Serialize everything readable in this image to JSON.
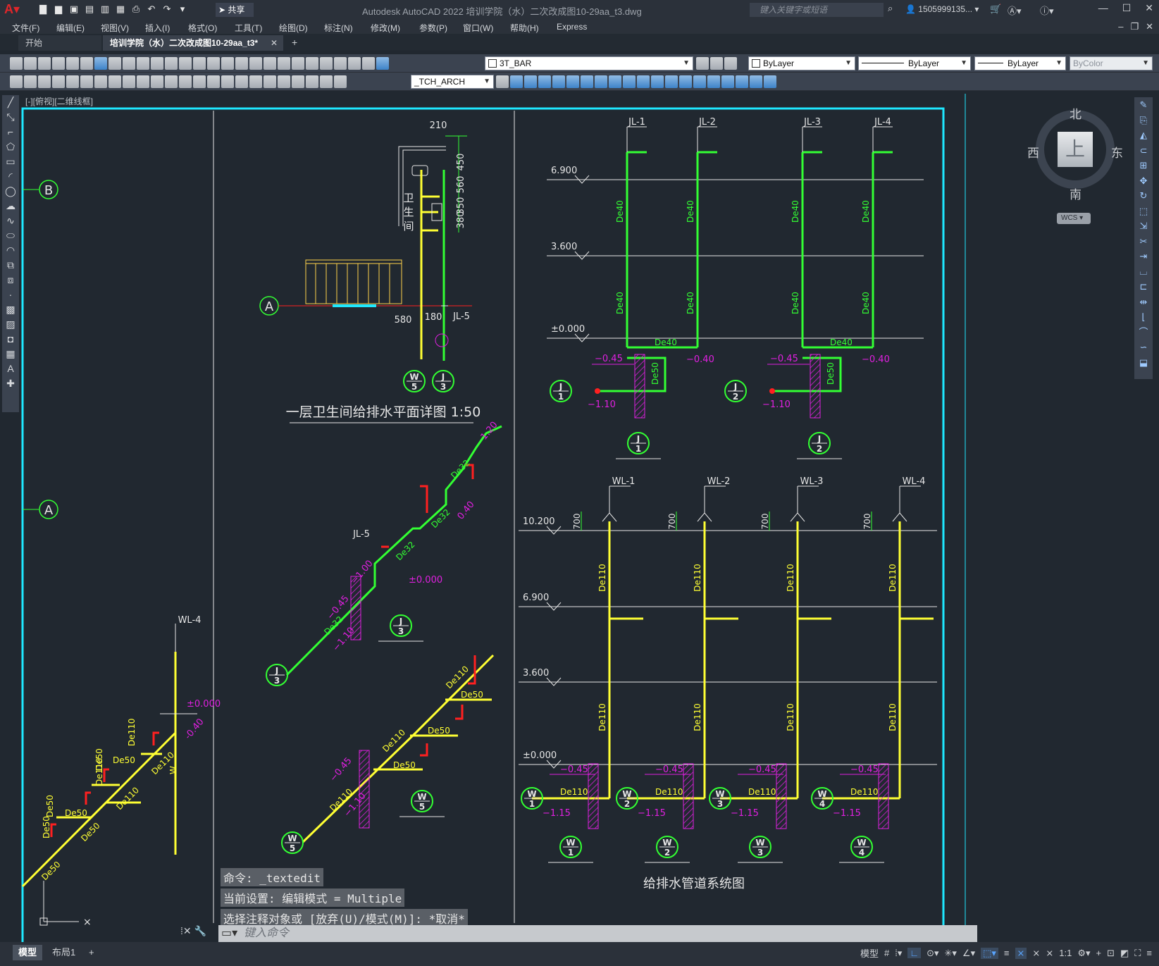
{
  "titlebar": {
    "title": "Autodesk AutoCAD 2022    培训学院（水）二次改成图10-29aa_t3.dwg",
    "share_label": "共享",
    "search_placeholder": "键入关键字或短语",
    "user": "1505999135...",
    "minimize": "—",
    "maximize": "☐",
    "close": "✕"
  },
  "menubar": {
    "items": [
      "文件(F)",
      "编辑(E)",
      "视图(V)",
      "插入(I)",
      "格式(O)",
      "工具(T)",
      "绘图(D)",
      "标注(N)",
      "修改(M)",
      "参数(P)",
      "窗口(W)",
      "帮助(H)",
      "Express"
    ]
  },
  "tabs": {
    "start": "开始",
    "doc": "培训学院（水）二次改成图10-29aa_t3*",
    "close": "✕",
    "add": "+"
  },
  "toolbar": {
    "layer": "3T_BAR",
    "color": "ByLayer",
    "linetype": "ByLayer",
    "lineweight": "ByLayer",
    "plotstyle": "ByColor",
    "textstyle": "_TCH_ARCH"
  },
  "viewport": {
    "label": "[-][俯视][二维线框]"
  },
  "viewcube": {
    "north": "北",
    "south": "南",
    "east": "东",
    "west": "西",
    "face": "上",
    "wcs": "WCS"
  },
  "drawing": {
    "plan_title": "一层卫生间给排水平面详图 1:50",
    "system_title": "给排水管道系统图",
    "room_label": [
      "卫",
      "生",
      "间"
    ],
    "axis_b": "B",
    "axis_a": "A",
    "dims": [
      "210",
      "450",
      "560",
      "350",
      "380",
      "580",
      "180"
    ],
    "levels": [
      "6.900",
      "3.600",
      "±0.000",
      "10.200",
      "6.900",
      "3.600",
      "±0.000"
    ],
    "risers_j": [
      "JL-1",
      "JL-2",
      "JL-3",
      "JL-4"
    ],
    "risers_w": [
      "WL-1",
      "WL-2",
      "WL-3",
      "WL-4"
    ],
    "jl5": "JL-5",
    "wl4": "WL-4",
    "pipe_labels": {
      "de40": "De40",
      "de50": "De50",
      "de110": "De110",
      "de32": "De32"
    },
    "elev_labels": {
      "m045": "−0.45",
      "m040": "−0.40",
      "m110": "−1.10",
      "m115": "−1.15",
      "m100": "−1.00",
      "p120": "1.20",
      "p040": "0.40",
      "zero": "±0.000",
      "m040b": "-0.40",
      "dim700": "700",
      "j": "J",
      "w": "W"
    },
    "tags_j": [
      {
        "letter": "J",
        "num": "1"
      },
      {
        "letter": "J",
        "num": "2"
      },
      {
        "letter": "J",
        "num": "3"
      }
    ],
    "tags_w": [
      {
        "letter": "W",
        "num": "1"
      },
      {
        "letter": "W",
        "num": "2"
      },
      {
        "letter": "W",
        "num": "3"
      },
      {
        "letter": "W",
        "num": "4"
      },
      {
        "letter": "W",
        "num": "5"
      }
    ]
  },
  "command": {
    "history": [
      "命令:  _textedit",
      "当前设置: 编辑模式 = Multiple",
      "选择注释对象或 [放弃(U)/模式(M)]: *取消*"
    ],
    "placeholder": "键入命令"
  },
  "status": {
    "model_tab": "模型",
    "layout_tab": "布局1",
    "add_tab": "+",
    "model_space": "模型",
    "scale": "1:1"
  },
  "colors": {
    "background": "#212830",
    "water_supply": "#33ff33",
    "drainage": "#ffff33",
    "dimension": "#e020e0",
    "valve": "#ff2020",
    "frame": "#1ee8ff",
    "white_line": "#e6e6e6"
  }
}
